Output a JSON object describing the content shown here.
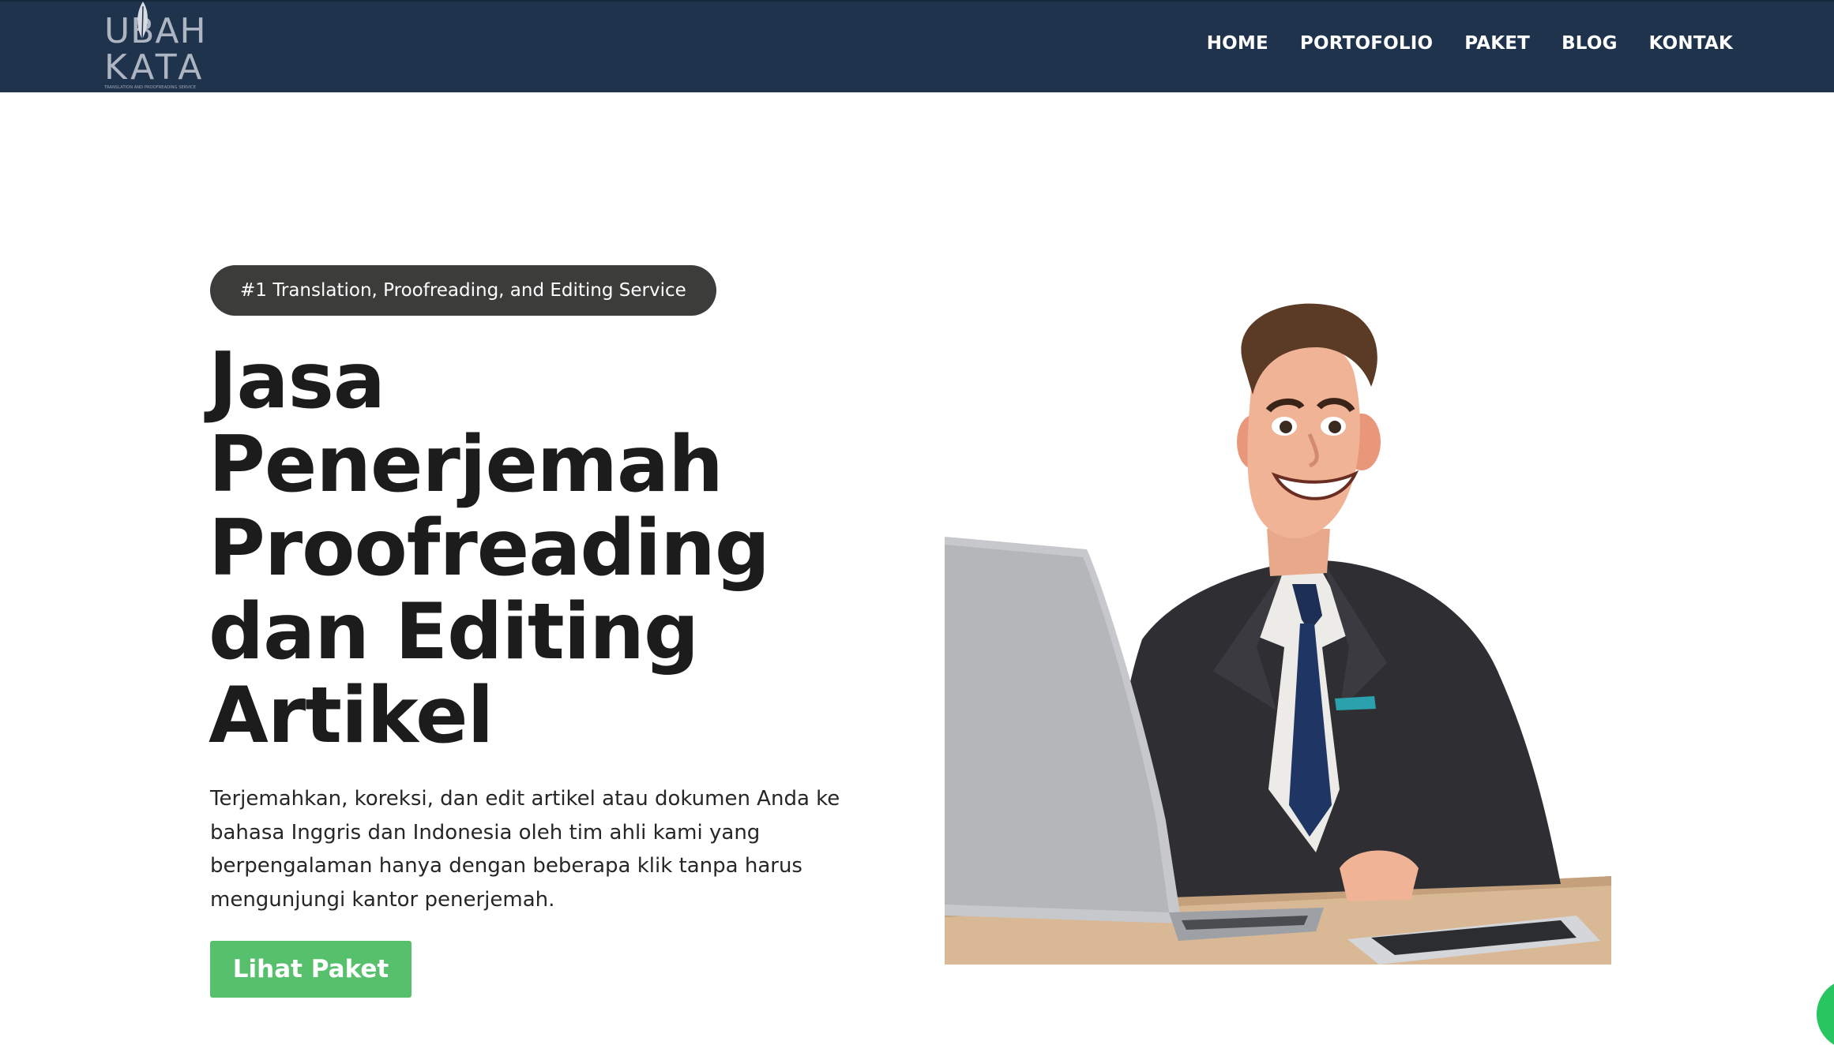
{
  "header": {
    "logo": {
      "line1": "UBAH",
      "line2": "KATA",
      "tagline": "TRANSLATION AND PROOFREADING SERVICE"
    },
    "nav": [
      {
        "label": "HOME"
      },
      {
        "label": "PORTOFOLIO"
      },
      {
        "label": "PAKET"
      },
      {
        "label": "BLOG"
      },
      {
        "label": "KONTAK"
      }
    ]
  },
  "hero": {
    "badge": "#1 Translation, Proofreading, and Editing Service",
    "title_lines": [
      "Jasa",
      "Penerjemah",
      "Proofreading",
      "dan Editing",
      "Artikel"
    ],
    "description": "Terjemahkan, koreksi, dan edit artikel atau dokumen Anda ke bahasa Inggris dan Indonesia oleh tim ahli kami yang berpengalaman hanya dengan beberapa klik tanpa harus mengunjungi kantor penerjemah.",
    "cta_label": "Lihat Paket",
    "illustration": "businessman-with-laptop-illustration"
  },
  "colors": {
    "header_bg": "#1f334d",
    "badge_bg": "#3c3c3a",
    "title": "#1c1c1c",
    "cta_bg": "#57c06c",
    "fab_bg": "#27c660"
  }
}
